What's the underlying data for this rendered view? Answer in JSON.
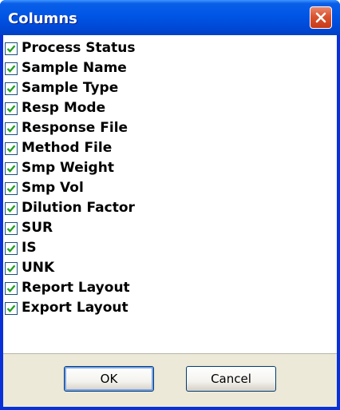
{
  "window": {
    "title": "Columns",
    "close_icon": "close-icon"
  },
  "columns": [
    {
      "label": "Process Status",
      "checked": true
    },
    {
      "label": "Sample Name",
      "checked": true
    },
    {
      "label": "Sample Type",
      "checked": true
    },
    {
      "label": "Resp Mode",
      "checked": true
    },
    {
      "label": "Response File",
      "checked": true
    },
    {
      "label": "Method File",
      "checked": true
    },
    {
      "label": "Smp Weight",
      "checked": true
    },
    {
      "label": "Smp Vol",
      "checked": true
    },
    {
      "label": "Dilution Factor",
      "checked": true
    },
    {
      "label": "SUR",
      "checked": true
    },
    {
      "label": "IS",
      "checked": true
    },
    {
      "label": "UNK",
      "checked": true
    },
    {
      "label": "Report Layout",
      "checked": true
    },
    {
      "label": "Export Layout",
      "checked": true
    }
  ],
  "buttons": {
    "ok_label": "OK",
    "cancel_label": "Cancel"
  },
  "colors": {
    "title_bar": "#0055e5",
    "close_button": "#d9532f",
    "check": "#21a121",
    "dialog_face": "#ece9d8"
  }
}
